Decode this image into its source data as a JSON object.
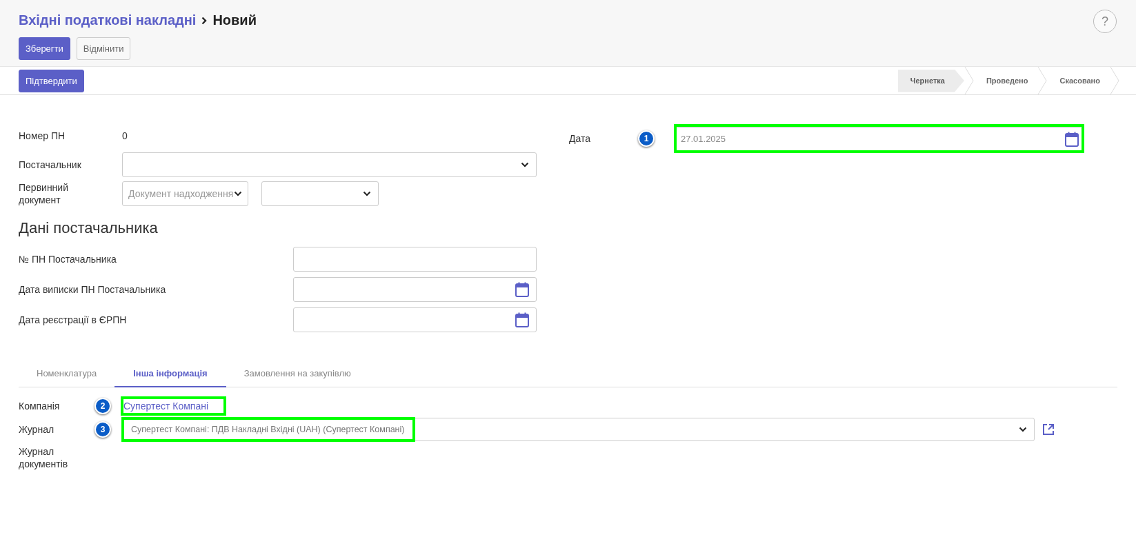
{
  "header": {
    "breadcrumb": "Вхідні податкові накладні",
    "current": "Новий",
    "help": "?"
  },
  "actions": [
    {
      "label": "Зберегти",
      "kind": "primary"
    },
    {
      "label": "Відмінити",
      "kind": "secondary"
    }
  ],
  "workflow_button": "Підтвердити",
  "stages": [
    {
      "label": "Чернетка",
      "selected": true
    },
    {
      "label": "Проведено",
      "selected": false
    },
    {
      "label": "Скасовано",
      "selected": false
    }
  ],
  "fields": [
    {
      "kind": "text",
      "label": "Номер ПН",
      "value": "0"
    },
    {
      "kind": "select",
      "label": "Постачальник"
    },
    {
      "kind": "double-select",
      "label": "Первинний документ",
      "placeholder": "Документ надходження"
    }
  ],
  "date": {
    "label": "Дата",
    "value": "27.01.2025",
    "marker": "1"
  },
  "section_title": "Дані постачальника",
  "supplier_fields": [
    {
      "kind": "input",
      "label": "№ ПН Постачальника"
    },
    {
      "kind": "date",
      "label": "Дата виписки ПН Постачальника"
    },
    {
      "kind": "date",
      "label": "Дата реєстрації в ЄРПН"
    }
  ],
  "tabs": [
    {
      "label": "Номенклатура",
      "selected": false
    },
    {
      "label": "Інша інформація",
      "selected": true
    },
    {
      "label": "Замовлення на закупівлю",
      "selected": false
    }
  ],
  "other_info": {
    "company": {
      "label": "Компанія",
      "value": "Супертест Компані",
      "marker": "2"
    },
    "journal": {
      "label": "Журнал",
      "value": "Супертест Компані: ПДВ Накладні Вхідні (UAH) (Супертест Компані)",
      "marker": "3"
    },
    "documents_journal": {
      "label": "Журнал документів"
    }
  }
}
